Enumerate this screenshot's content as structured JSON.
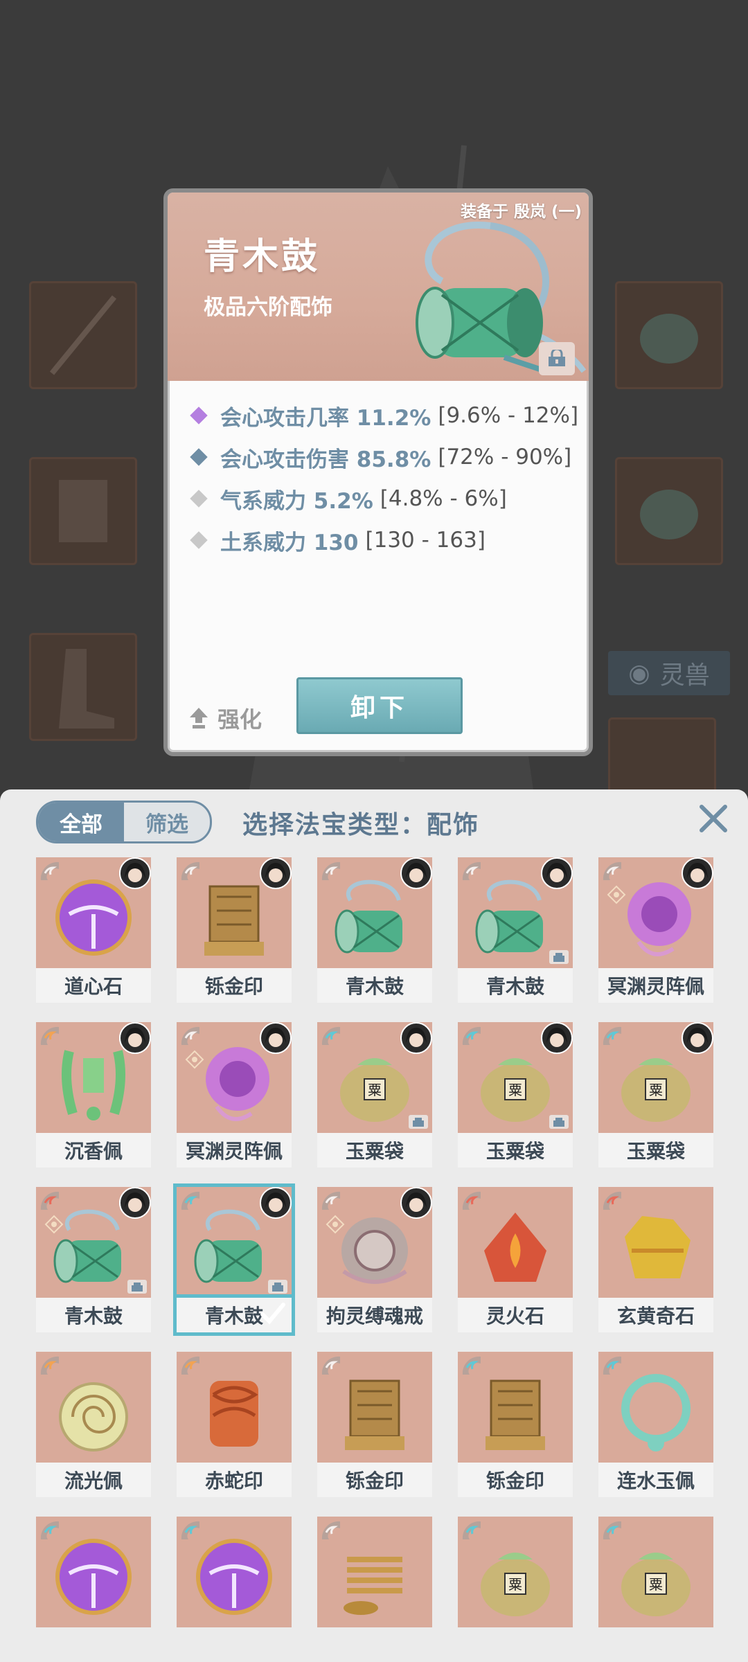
{
  "detail": {
    "equipped_by": "装备于 殷岚 (一)",
    "name": "青木鼓",
    "grade": "极品六阶配饰",
    "stats": [
      {
        "name": "会心攻击几率 11.2%",
        "range": "[9.6% - 12%]",
        "color": "#b47fe0"
      },
      {
        "name": "会心攻击伤害 85.8%",
        "range": "[72% - 90%]",
        "color": "#6f8ea5"
      },
      {
        "name": "气系威力 5.2%",
        "range": "[4.8% - 6%]",
        "color": "#c8c8c8"
      },
      {
        "name": "土系威力 130",
        "range": "[130 - 163]",
        "color": "#c8c8c8"
      }
    ],
    "enhance_label": "强化",
    "unequip_label": "卸下"
  },
  "background": {
    "beast_button": "灵兽"
  },
  "inventory": {
    "tab_all": "全部",
    "tab_filter": "筛选",
    "title": "选择法宝类型：配饰",
    "items": [
      {
        "name": "道心石",
        "art": "orb",
        "elem": "white",
        "avatar": true,
        "lock": false,
        "swirl": false
      },
      {
        "name": "铄金印",
        "art": "seal",
        "elem": "white",
        "avatar": true,
        "lock": false,
        "swirl": false
      },
      {
        "name": "青木鼓",
        "art": "drum",
        "elem": "white",
        "avatar": true,
        "lock": false,
        "swirl": false
      },
      {
        "name": "青木鼓",
        "art": "drum",
        "elem": "white",
        "avatar": true,
        "lock": true,
        "swirl": false
      },
      {
        "name": "冥渊灵阵佩",
        "art": "purple",
        "elem": "white",
        "avatar": true,
        "lock": false,
        "swirl": true
      },
      {
        "name": "沉香佩",
        "art": "jade",
        "elem": "orange",
        "avatar": true,
        "lock": false,
        "swirl": false
      },
      {
        "name": "冥渊灵阵佩",
        "art": "purple",
        "elem": "white",
        "avatar": true,
        "lock": false,
        "swirl": true
      },
      {
        "name": "玉粟袋",
        "art": "bag",
        "elem": "cyan",
        "avatar": true,
        "lock": true,
        "swirl": false
      },
      {
        "name": "玉粟袋",
        "art": "bag",
        "elem": "cyan",
        "avatar": true,
        "lock": true,
        "swirl": false
      },
      {
        "name": "玉粟袋",
        "art": "bag",
        "elem": "cyan",
        "avatar": true,
        "lock": false,
        "swirl": false
      },
      {
        "name": "青木鼓",
        "art": "drum",
        "elem": "red",
        "avatar": true,
        "lock": true,
        "swirl": true
      },
      {
        "name": "青木鼓",
        "art": "drum",
        "elem": "cyan",
        "avatar": true,
        "lock": true,
        "swirl": false,
        "selected": true
      },
      {
        "name": "拘灵缚魂戒",
        "art": "ring",
        "elem": "white",
        "avatar": true,
        "lock": false,
        "swirl": true
      },
      {
        "name": "灵火石",
        "art": "fire",
        "elem": "red",
        "avatar": false,
        "lock": false,
        "swirl": false
      },
      {
        "name": "玄黄奇石",
        "art": "gold",
        "elem": "red",
        "avatar": false,
        "lock": false,
        "swirl": false
      },
      {
        "name": "流光佩",
        "art": "disc",
        "elem": "orange",
        "avatar": false,
        "lock": false,
        "swirl": false
      },
      {
        "name": "赤蛇印",
        "art": "snake",
        "elem": "orange",
        "avatar": false,
        "lock": false,
        "swirl": false
      },
      {
        "name": "铄金印",
        "art": "seal",
        "elem": "white",
        "avatar": false,
        "lock": false,
        "swirl": false
      },
      {
        "name": "铄金印",
        "art": "seal",
        "elem": "cyan",
        "avatar": false,
        "lock": false,
        "swirl": false
      },
      {
        "name": "连水玉佩",
        "art": "necklace",
        "elem": "cyan",
        "avatar": false,
        "lock": false,
        "swirl": false
      },
      {
        "name": "",
        "art": "orb",
        "elem": "cyan",
        "avatar": false,
        "lock": false,
        "swirl": false
      },
      {
        "name": "",
        "art": "orb",
        "elem": "cyan",
        "avatar": false,
        "lock": false,
        "swirl": false
      },
      {
        "name": "",
        "art": "coil",
        "elem": "white",
        "avatar": false,
        "lock": false,
        "swirl": false
      },
      {
        "name": "",
        "art": "bag",
        "elem": "cyan",
        "avatar": false,
        "lock": false,
        "swirl": false
      },
      {
        "name": "",
        "art": "bag",
        "elem": "cyan",
        "avatar": false,
        "lock": false,
        "swirl": false
      }
    ]
  },
  "colors": {
    "accent_blue": "#6f8ea5",
    "selected_outline": "#5fbbcb",
    "card_header": "#d6aa9a",
    "item_bg": "#d9aa9a"
  }
}
